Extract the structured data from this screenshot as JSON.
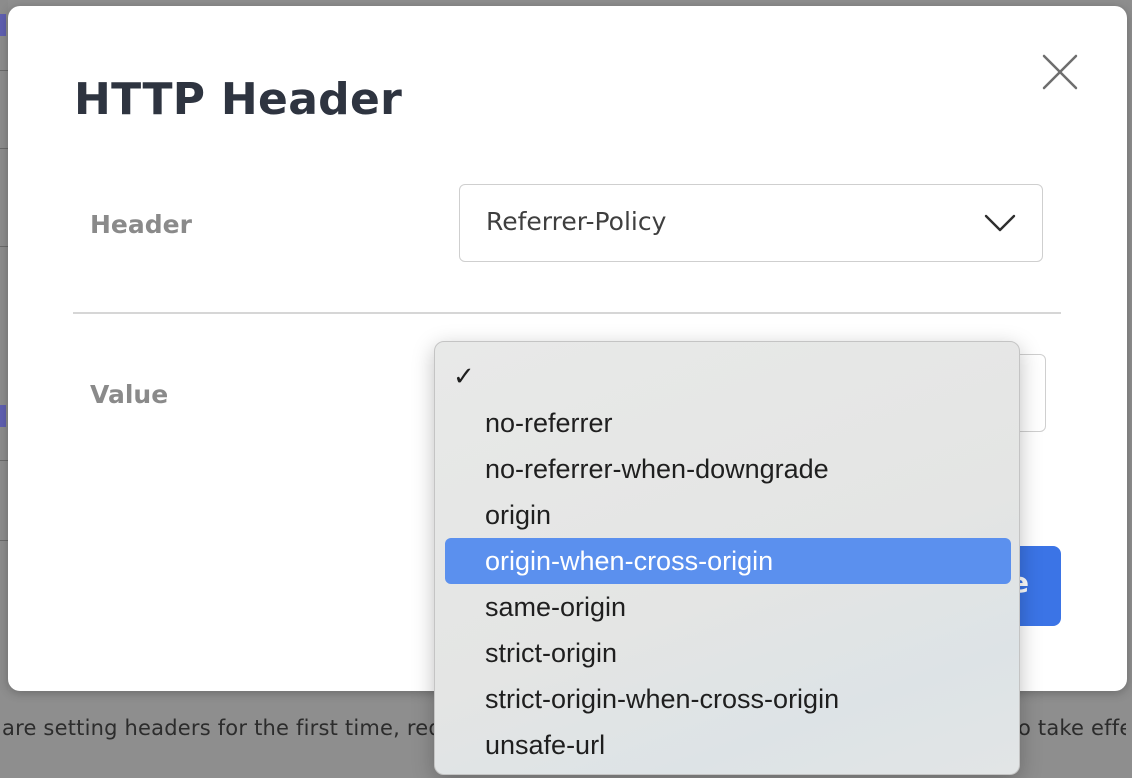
{
  "background": {
    "footer_left_text": "are setting headers for the first time, rede",
    "footer_right_text": "o take effe"
  },
  "modal": {
    "title": "HTTP Header",
    "close_icon": "close-icon",
    "header_label": "Header",
    "header_select_value": "Referrer-Policy",
    "value_label": "Value",
    "save_label": "e"
  },
  "dropdown": {
    "options": [
      {
        "label": "",
        "checked": true
      },
      {
        "label": "no-referrer",
        "checked": false
      },
      {
        "label": "no-referrer-when-downgrade",
        "checked": false
      },
      {
        "label": "origin",
        "checked": false
      },
      {
        "label": "origin-when-cross-origin",
        "checked": false,
        "highlighted": true
      },
      {
        "label": "same-origin",
        "checked": false
      },
      {
        "label": "strict-origin",
        "checked": false
      },
      {
        "label": "strict-origin-when-cross-origin",
        "checked": false
      },
      {
        "label": "unsafe-url",
        "checked": false
      }
    ],
    "check_glyph": "✓"
  },
  "colors": {
    "accent": "#3b74e6",
    "highlight": "#5b90ee",
    "title": "#2e3440",
    "label": "#8a8a8a"
  }
}
